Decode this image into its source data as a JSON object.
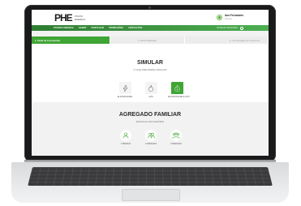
{
  "header": {
    "logo_mark": "PHE",
    "logo_line1": "POUPA",
    "logo_line2": "ENERGIA",
    "user_name": "Ana Fernandes",
    "user_role": "Cliente"
  },
  "nav": {
    "links": [
      "POUPAR ENERGIA",
      "SABER",
      "PARTILHAR",
      "PROMOÇÕES",
      "CONTACTOS"
    ],
    "right_text": "OS MEUS CONSUMOS"
  },
  "steps": [
    "1. Perfil de Consumidor",
    "2. Perfil Habitação",
    "3. Comparação de Consumos"
  ],
  "simular": {
    "title": "SIMULAR",
    "subtitle": "O QUE PRETENDE SIMULAR",
    "options": [
      {
        "label": "ELETRICIDADE",
        "icon": "lightning-icon",
        "selected": false
      },
      {
        "label": "GÁS",
        "icon": "flame-icon",
        "selected": false
      },
      {
        "label": "ELETRICIDADE E GÁS",
        "icon": "lightning-flame-icon",
        "selected": true
      }
    ]
  },
  "agregado": {
    "title": "AGREGADO FAMILIAR",
    "subtitle": "ESCOLHA UM CENÁRIO",
    "options": [
      {
        "label": "1 PESSOA",
        "icon": "person-icon"
      },
      {
        "label": "2 PESSOAS",
        "icon": "couple-icon"
      },
      {
        "label": "3 PESSOAS",
        "icon": "family-icon"
      }
    ]
  },
  "colors": {
    "brand_green": "#3fa535",
    "nav_green": "#2e7d32"
  }
}
